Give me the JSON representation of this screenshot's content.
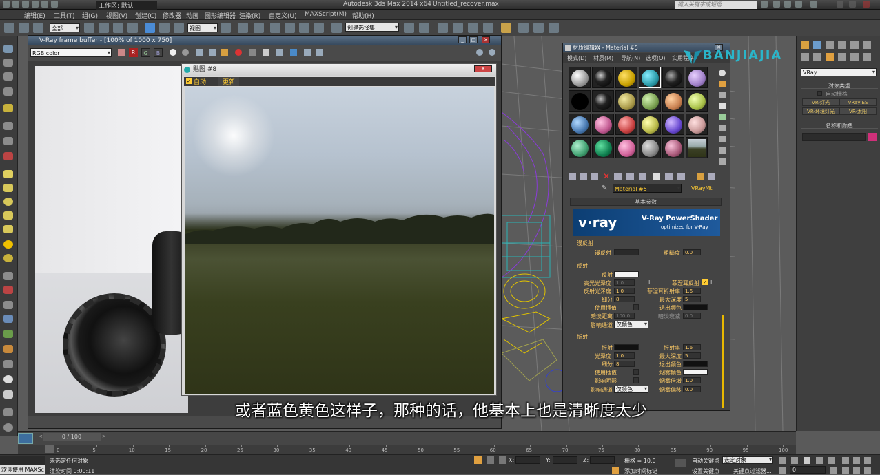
{
  "app": {
    "title": "Autodesk 3ds Max  2014 x64",
    "file": "Untitled_recover.max",
    "workspace_label": "工作区: 默认",
    "search_placeholder": "键入关键字或短语"
  },
  "menu": [
    "编辑(E)",
    "工具(T)",
    "组(G)",
    "视图(V)",
    "创建(C)",
    "修改器",
    "动画",
    "图形编辑器",
    "渲染(R)",
    "自定义(U)",
    "MAXScript(M)",
    "帮助(H)"
  ],
  "toolbar": {
    "selection_filter": "全部",
    "ref_coord": "视图",
    "named_selection": "创建选择集"
  },
  "vfb": {
    "title": "V-Ray frame buffer - [100% of 1000 x 750]",
    "channel": "RGB color",
    "btn_r": "R",
    "btn_g": "G",
    "btn_b": "B"
  },
  "map_window": {
    "title": "贴图 #8",
    "auto_label": "自动",
    "update_label": "更新"
  },
  "material_editor": {
    "title": "材质编辑器 - Material #5",
    "menu": [
      "模式(D)",
      "材质(M)",
      "导航(N)",
      "选项(O)",
      "实用程序"
    ],
    "material_name": "Material #5",
    "material_type": "VRayMtl",
    "basic_params": "基本参数",
    "banner_brand": "v·ray",
    "banner_title": "V-Ray PowerShader",
    "banner_sub": "optimized for V-Ray",
    "diffuse_group": "漫反射",
    "diffuse_label": "漫反射",
    "roughness_label": "粗糙度",
    "roughness_value": "0.0",
    "reflect_group": "反射",
    "reflect_label": "反射",
    "hilight_gloss_label": "高光光泽度",
    "hilight_gloss_value": "1.0",
    "refl_gloss_label": "反射光泽度",
    "refl_gloss_value": "1.0",
    "subdivs_label": "细分",
    "subdivs_value": "8",
    "use_interp_label": "使用插值",
    "dim_distance_label": "暗淡距离",
    "dim_distance_value": "100.0",
    "affect_channels_label": "影响通道",
    "affect_channels_value": "仅颜色",
    "fresnel_label": "菲涅耳反射",
    "fresnel_ior_label": "菲涅耳折射率",
    "fresnel_ior_value": "1.6",
    "max_depth_label": "最大深度",
    "max_depth_value": "5",
    "exit_color_label": "退出颜色",
    "dim_falloff_label": "暗淡衰减",
    "dim_falloff_value": "0.0",
    "L": "L",
    "refract_group": "折射",
    "refract_label": "折射",
    "ior_label": "折射率",
    "ior_value": "1.6",
    "r_gloss_label": "光泽度",
    "r_gloss_value": "1.0",
    "r_max_depth_label": "最大深度",
    "r_max_depth_value": "5",
    "r_subdivs_label": "细分",
    "r_subdivs_value": "8",
    "r_exit_label": "退出颜色",
    "r_interp_label": "使用插值",
    "fog_color_label": "烟雾颜色",
    "shadows_label": "影响阴影",
    "fog_mult_label": "烟雾倍增",
    "fog_mult_value": "1.0",
    "r_affect_label": "影响通道",
    "r_affect_value": "仅颜色",
    "fog_bias_label": "烟雾偏移",
    "fog_bias_value": "0.0"
  },
  "logo_text": "BANJIAJIA",
  "command_panel": {
    "renderer": "VRay",
    "object_type": "对象类型",
    "auto_grid": "自动栅格",
    "btn1": "VR-灯光",
    "btn2": "VRayIES",
    "btn3": "VR-环境灯光",
    "btn4": "VR-太阳",
    "name_color": "名称和颜色",
    "name_color_swatch": "#d0307a"
  },
  "timeline": {
    "frame": "0 / 100",
    "ticks": [
      "0",
      "5",
      "10",
      "15",
      "20",
      "25",
      "30",
      "35",
      "40",
      "45",
      "50",
      "55",
      "60",
      "65",
      "70",
      "75",
      "80",
      "85",
      "90",
      "95",
      "100"
    ]
  },
  "status": {
    "welcome": "欢迎使用 MAXSc",
    "line1": "未选定任何对象",
    "line2": "渲染时间 0:00:11",
    "x_label": "X:",
    "y_label": "Y:",
    "z_label": "Z:",
    "grid": "栅格 = 10.0",
    "add_time_tag": "添加时间标记",
    "auto_key": "自动关键点",
    "set_key": "设置关键点",
    "selected": "选定对象",
    "key_filters": "关键点过滤器...",
    "frame_field": "0"
  },
  "subtitle": "或者蓝色黄色这样子，那种的话，他基本上也是清晰度太少",
  "colors": {
    "accent_yellow": "#ffcc33",
    "vray_blue": "#1f5a9c",
    "brand_teal": "#2ab5c9"
  }
}
